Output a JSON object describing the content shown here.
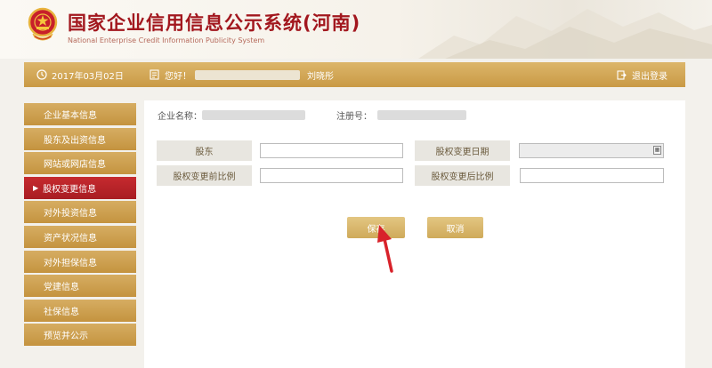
{
  "header": {
    "title": "国家企业信用信息公示系统(河南)",
    "subtitle": "National Enterprise Credit Information Publicity System"
  },
  "topbar": {
    "date": "2017年03月02日",
    "greeting": "您好！",
    "user_name": "刘晓彤",
    "logout": "退出登录"
  },
  "sidebar": {
    "items": [
      {
        "label": "企业基本信息"
      },
      {
        "label": "股东及出资信息"
      },
      {
        "label": "网站或网店信息"
      },
      {
        "label": "股权变更信息",
        "active": true
      },
      {
        "label": "对外投资信息"
      },
      {
        "label": "资产状况信息"
      },
      {
        "label": "对外担保信息"
      },
      {
        "label": "党建信息"
      },
      {
        "label": "社保信息"
      },
      {
        "label": "预览并公示"
      }
    ]
  },
  "company": {
    "name_label": "企业名称：",
    "reg_label": "注册号："
  },
  "form": {
    "shareholder_label": "股东",
    "change_date_label": "股权变更日期",
    "before_ratio_label": "股权变更前比例",
    "after_ratio_label": "股权变更后比例",
    "shareholder_value": "",
    "change_date_value": "",
    "before_ratio_value": "",
    "after_ratio_value": ""
  },
  "buttons": {
    "save": "保存",
    "cancel": "取消"
  },
  "colors": {
    "brand_red": "#a2171e",
    "gold": "#c99a45",
    "active_red": "#b32228"
  },
  "icons": {
    "emblem": "national-emblem-icon",
    "calendar": "calendar-icon",
    "clock": "clock-icon",
    "user": "user-icon",
    "logout": "logout-icon",
    "pointer": "red-arrow-pointer"
  }
}
